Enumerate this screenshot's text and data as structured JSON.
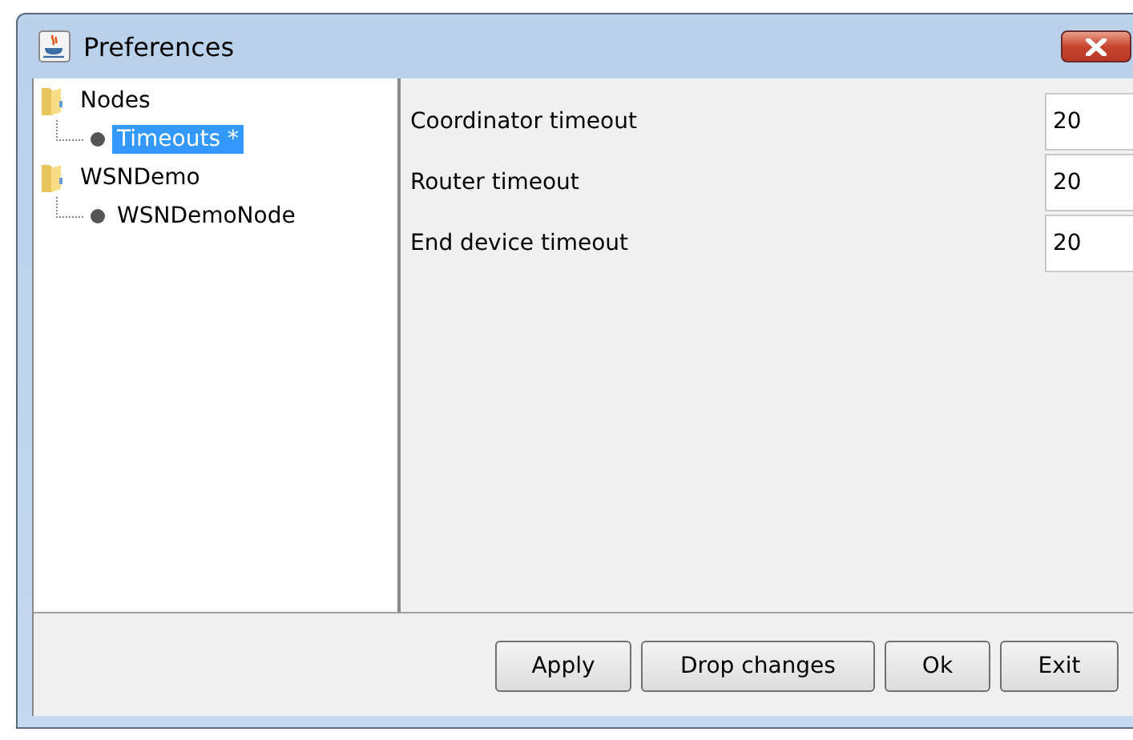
{
  "window": {
    "title": "Preferences"
  },
  "tree": [
    {
      "label": "Nodes",
      "kind": "folder",
      "selected": false,
      "children": [
        {
          "label": "Timeouts *",
          "kind": "leaf",
          "selected": true
        }
      ]
    },
    {
      "label": "WSNDemo",
      "kind": "folder",
      "selected": false,
      "children": [
        {
          "label": "WSNDemoNode",
          "kind": "leaf",
          "selected": false
        }
      ]
    }
  ],
  "fields": [
    {
      "label": "Coordinator timeout",
      "value": "20"
    },
    {
      "label": "Router timeout",
      "value": "20"
    },
    {
      "label": "End device timeout",
      "value": "20"
    }
  ],
  "buttons": [
    "Apply",
    "Drop changes",
    "Ok",
    "Exit"
  ]
}
